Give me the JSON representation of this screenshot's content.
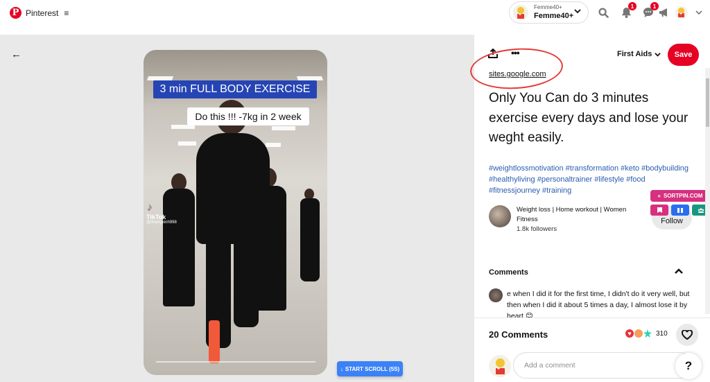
{
  "header": {
    "logo_text": "Pinterest",
    "menu_icon": "≡",
    "account": {
      "small_label": "Femme40+",
      "name": "Femme40+"
    },
    "notifications_badge": "1",
    "messages_badge": "1"
  },
  "stage": {
    "back_icon": "←",
    "video": {
      "caption_title": "3 min FULL BODY EXERCISE",
      "caption_sub": "Do this !!! -7kg in 2 week",
      "tiktok_label": "TikTok",
      "tiktok_handle": "@nhungxinh998"
    },
    "scroll_button": "START SCROLL (5S)"
  },
  "pin": {
    "board": "First Aids",
    "save_label": "Save",
    "source": "sites.google.com",
    "title": "Only You Can do 3 minutes exercise every days and lose your weght easily.",
    "hashtags": "#weightlossmotivation #transformation #keto #bodybuilding #healthyliving #personaltrainer #lifestyle #food #fitnessjourney #training",
    "creator": {
      "name": "Weight loss | Home workout | Women Fitness",
      "followers": "1.8k followers",
      "follow_label": "Follow"
    },
    "sortpin": {
      "label": "SORTPIN.COM",
      "colors": {
        "pink": "#d6307f",
        "blue": "#2a6ef0",
        "teal": "#1a9680"
      }
    },
    "comments": {
      "header": "Comments",
      "items": [
        {
          "text": "e when I did it for the first time, I didn't do it very well, but then when I did it about 5 times a day, I almost lose it by heart 😊"
        }
      ],
      "count_label": "20 Comments",
      "reaction_count": "310",
      "input_placeholder": "Add a comment"
    },
    "help_label": "?"
  },
  "colors": {
    "brand": "#e60023",
    "link": "#2a5db0",
    "annotation": "#e53935"
  }
}
